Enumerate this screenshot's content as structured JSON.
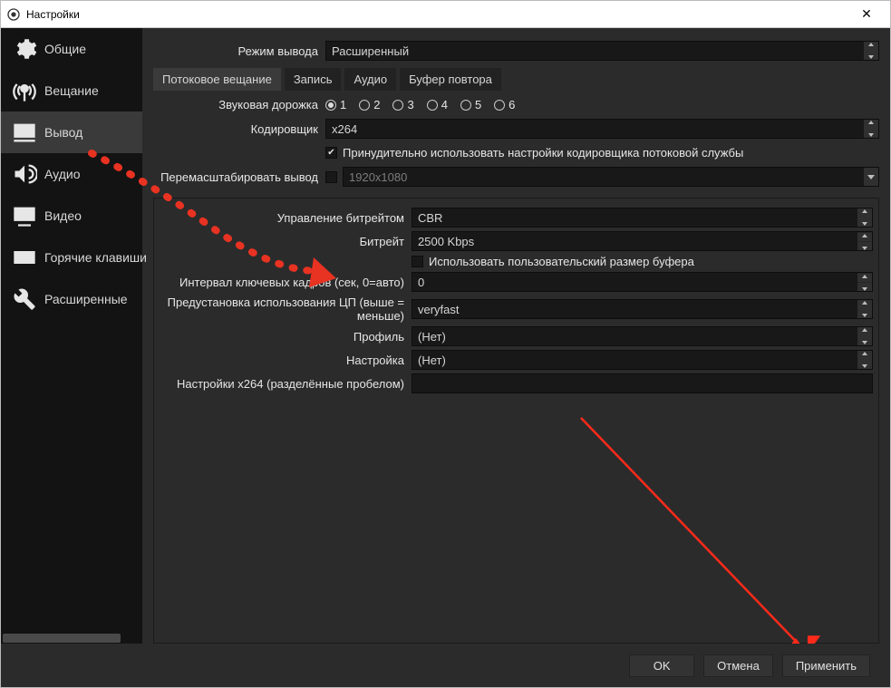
{
  "window": {
    "title": "Настройки"
  },
  "sidebar": {
    "items": [
      {
        "id": "general",
        "label": "Общие"
      },
      {
        "id": "stream",
        "label": "Вещание"
      },
      {
        "id": "output",
        "label": "Вывод"
      },
      {
        "id": "audio",
        "label": "Аудио"
      },
      {
        "id": "video",
        "label": "Видео"
      },
      {
        "id": "hotkeys",
        "label": "Горячие клавиши"
      },
      {
        "id": "advanced",
        "label": "Расширенные"
      }
    ],
    "active": 2
  },
  "outputMode": {
    "label": "Режим вывода",
    "value": "Расширенный"
  },
  "tabs": {
    "items": [
      {
        "id": "streaming",
        "label": "Потоковое вещание"
      },
      {
        "id": "recording",
        "label": "Запись"
      },
      {
        "id": "audio",
        "label": "Аудио"
      },
      {
        "id": "replay",
        "label": "Буфер повтора"
      }
    ],
    "active": 0
  },
  "audioTrack": {
    "label": "Звуковая дорожка",
    "options": [
      "1",
      "2",
      "3",
      "4",
      "5",
      "6"
    ],
    "selected": 0
  },
  "encoder": {
    "label": "Кодировщик",
    "value": "x264"
  },
  "enforce": {
    "checked": true,
    "label": "Принудительно использовать настройки кодировщика потоковой службы"
  },
  "rescale": {
    "label": "Перемасштабировать вывод",
    "checked": false,
    "value": "1920x1080"
  },
  "rateControl": {
    "label": "Управление битрейтом",
    "value": "CBR"
  },
  "bitrate": {
    "label": "Битрейт",
    "value": "2500 Kbps"
  },
  "customBuf": {
    "checked": false,
    "label": "Использовать пользовательский размер буфера"
  },
  "keyint": {
    "label": "Интервал ключевых кадров (сек, 0=авто)",
    "value": "0"
  },
  "cpuPreset": {
    "label": "Предустановка использования ЦП (выше = меньше)",
    "value": "veryfast"
  },
  "profile": {
    "label": "Профиль",
    "value": "(Нет)"
  },
  "tune": {
    "label": "Настройка",
    "value": "(Нет)"
  },
  "x264opts": {
    "label": "Настройки x264 (разделённые пробелом)",
    "value": ""
  },
  "buttons": {
    "ok": "OK",
    "cancel": "Отмена",
    "apply": "Применить"
  }
}
